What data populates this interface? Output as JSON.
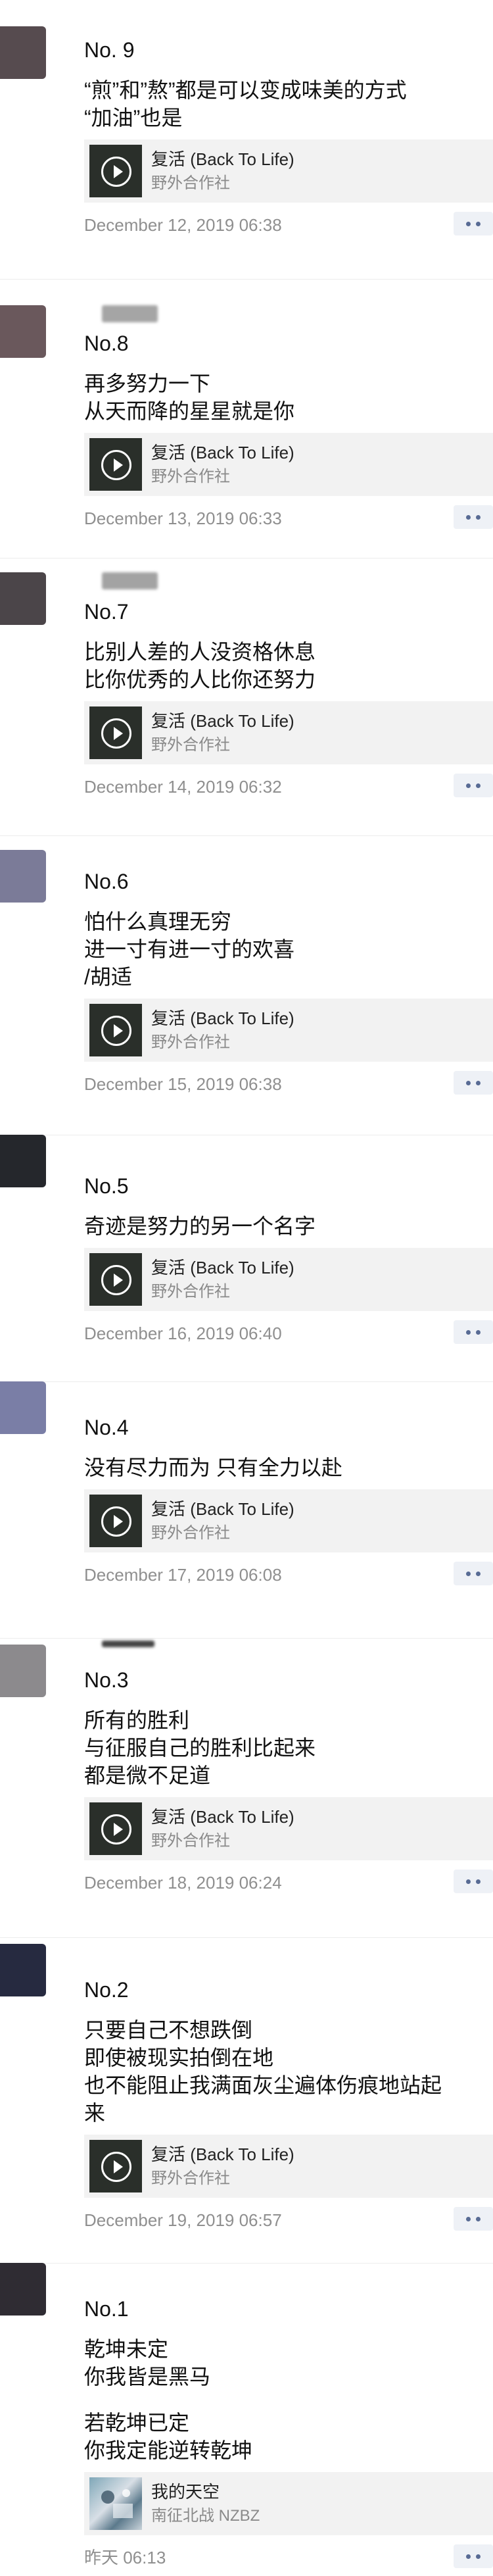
{
  "colors": {
    "more_dots": "#586b94",
    "card_bg": "#f2f2f2",
    "time": "#8f8f8f"
  },
  "posts": [
    {
      "no": "No. 9",
      "lines": [
        "“煎”和”熬”都是可以变成味美的方式",
        "“加油”也是"
      ],
      "music": {
        "title": "复活 (Back To Life)",
        "artist": "野外合作社",
        "icon": "play-icon"
      },
      "time": "December 12, 2019 06:38",
      "avatar_color": "#564b4f"
    },
    {
      "no": "No.8",
      "lines": [
        "再多努力一下",
        "从天而降的星星就是你"
      ],
      "music": {
        "title": "复活 (Back To Life)",
        "artist": "野外合作社",
        "icon": "play-icon"
      },
      "time": "December 13, 2019 06:33",
      "avatar_color": "#6a585c"
    },
    {
      "no": "No.7",
      "lines": [
        "比别人差的人没资格休息",
        "比你优秀的人比你还努力"
      ],
      "music": {
        "title": "复活 (Back To Life)",
        "artist": "野外合作社",
        "icon": "play-icon"
      },
      "time": "December 14, 2019 06:32",
      "avatar_color": "#4b4549"
    },
    {
      "no": "No.6",
      "lines": [
        "怕什么真理无穷",
        "进一寸有进一寸的欢喜",
        "/胡适"
      ],
      "music": {
        "title": "复活 (Back To Life)",
        "artist": "野外合作社",
        "icon": "play-icon"
      },
      "time": "December 15, 2019 06:38",
      "avatar_color": "#7b7b98"
    },
    {
      "no": "No.5",
      "lines": [
        "奇迹是努力的另一个名字"
      ],
      "music": {
        "title": "复活 (Back To Life)",
        "artist": "野外合作社",
        "icon": "play-icon"
      },
      "time": "December 16, 2019 06:40",
      "avatar_color": "#25272c"
    },
    {
      "no": "No.4",
      "lines": [
        "没有尽力而为 只有全力以赴"
      ],
      "music": {
        "title": "复活 (Back To Life)",
        "artist": "野外合作社",
        "icon": "play-icon"
      },
      "time": "December 17, 2019 06:08",
      "avatar_color": "#7a7ea6"
    },
    {
      "no": "No.3",
      "lines": [
        "所有的胜利",
        "与征服自己的胜利比起来",
        "都是微不足道"
      ],
      "music": {
        "title": "复活 (Back To Life)",
        "artist": "野外合作社",
        "icon": "play-icon"
      },
      "time": "December 18, 2019 06:24",
      "avatar_color": "#8c8a8d"
    },
    {
      "no": "No.2",
      "lines": [
        "只要自己不想跌倒",
        "即使被现实拍倒在地",
        "也不能阻止我满面灰尘遍体伤痕地站起",
        "来"
      ],
      "music": {
        "title": "复活 (Back To Life)",
        "artist": "野外合作社",
        "icon": "play-icon"
      },
      "time": "December 19, 2019 06:57",
      "avatar_color": "#262a40"
    },
    {
      "no": "No.1",
      "lines": [
        "乾坤未定",
        "你我皆是黑马",
        "",
        "若乾坤已定",
        "你我定能逆转乾坤"
      ],
      "music": {
        "title": "我的天空",
        "artist": "南征北战 NZBZ",
        "icon": "album-art-icon"
      },
      "time": "昨天 06:13",
      "avatar_color": "#2f2c33"
    }
  ]
}
